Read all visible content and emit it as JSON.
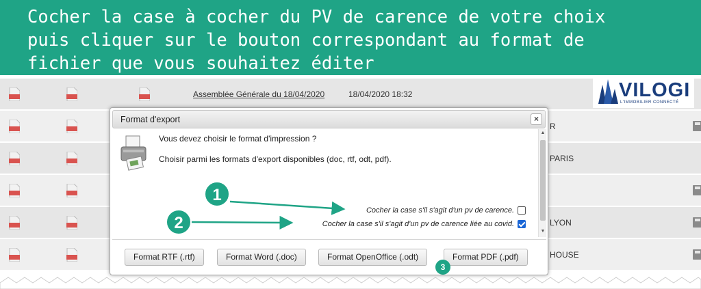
{
  "banner": {
    "line1": "Cocher la case à cocher du PV de carence de votre choix",
    "line2": "puis cliquer sur le bouton correspondant au format de",
    "line3": "fichier que vous souhaitez éditer"
  },
  "background": {
    "row1_link": "Assemblée Générale du 18/04/2020",
    "row1_date": "18/04/2020 18:32",
    "row2_frag": "R",
    "row3_frag": "PARIS",
    "row5_frag": "LYON",
    "row6_frag": "HOUSE",
    "pdf_label": "PDF"
  },
  "logo": {
    "name": "VILOGI",
    "tagline": "L'IMMOBILIER CONNECTÉ"
  },
  "dialog": {
    "title": "Format d'export",
    "close": "×",
    "question": "Vous devez choisir le format d'impression ?",
    "choose": "Choisir parmi les formats d'export disponibles (doc, rtf, odt, pdf).",
    "checkbox1_label": "Cocher la case s'il s'agit d'un pv de carence.",
    "checkbox1_checked": false,
    "checkbox2_label": "Cocher la case s'il s'agit d'un pv de carence liée au covid.",
    "checkbox2_checked": true,
    "buttons": {
      "rtf": "Format RTF (.rtf)",
      "word": "Format Word (.doc)",
      "odt": "Format OpenOffice (.odt)",
      "pdf": "Format PDF (.pdf)"
    }
  },
  "annotations": {
    "badge1": "1",
    "badge2": "2",
    "badge3": "3"
  },
  "colors": {
    "accent": "#1fa486",
    "checkbox": "#1a66d6"
  }
}
